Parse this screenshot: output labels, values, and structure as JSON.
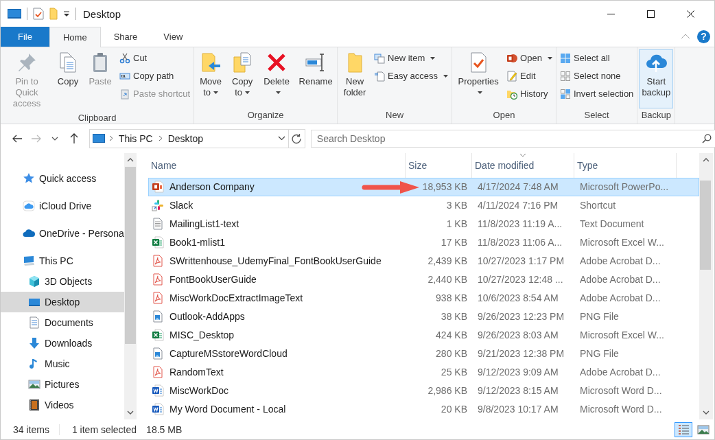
{
  "window": {
    "title": "Desktop"
  },
  "ribbon_tabs": [
    {
      "label": "File",
      "kind": "file",
      "selected": false
    },
    {
      "label": "Home",
      "kind": "tab",
      "selected": true
    },
    {
      "label": "Share",
      "kind": "tab",
      "selected": false
    },
    {
      "label": "View",
      "kind": "tab",
      "selected": false
    }
  ],
  "help_label": "?",
  "ribbon_groups": [
    {
      "label": "Clipboard",
      "items": [
        {
          "kind": "large",
          "label": "Pin to Quick access",
          "disabled": true,
          "dropdown": false,
          "highlighted": false
        },
        {
          "kind": "large",
          "label": "Copy",
          "disabled": false,
          "dropdown": false,
          "highlighted": false
        },
        {
          "kind": "large",
          "label": "Paste",
          "disabled": true,
          "dropdown": false,
          "highlighted": false
        },
        {
          "kind": "small",
          "label": "Cut",
          "disabled": false,
          "dropdown": false,
          "highlighted": false
        },
        {
          "kind": "small",
          "label": "Copy path",
          "disabled": false,
          "dropdown": false,
          "highlighted": false
        },
        {
          "kind": "small",
          "label": "Paste shortcut",
          "disabled": true,
          "dropdown": false,
          "highlighted": false
        }
      ]
    },
    {
      "label": "Organize",
      "items": [
        {
          "kind": "large",
          "label": "Move to",
          "disabled": false,
          "dropdown": true,
          "highlighted": false
        },
        {
          "kind": "large",
          "label": "Copy to",
          "disabled": false,
          "dropdown": true,
          "highlighted": false
        },
        {
          "kind": "large",
          "label": "Delete",
          "disabled": false,
          "dropdown": true,
          "highlighted": false
        },
        {
          "kind": "large",
          "label": "Rename",
          "disabled": false,
          "dropdown": false,
          "highlighted": false
        }
      ]
    },
    {
      "label": "New",
      "items": [
        {
          "kind": "large",
          "label": "New folder",
          "disabled": false,
          "dropdown": false,
          "highlighted": false
        },
        {
          "kind": "small",
          "label": "New item",
          "disabled": false,
          "dropdown": true,
          "highlighted": false
        },
        {
          "kind": "small",
          "label": "Easy access",
          "disabled": false,
          "dropdown": true,
          "highlighted": false
        }
      ]
    },
    {
      "label": "Open",
      "items": [
        {
          "kind": "large",
          "label": "Properties",
          "disabled": false,
          "dropdown": true,
          "highlighted": false
        },
        {
          "kind": "small",
          "label": "Open",
          "disabled": false,
          "dropdown": true,
          "highlighted": false
        },
        {
          "kind": "small",
          "label": "Edit",
          "disabled": false,
          "dropdown": false,
          "highlighted": false
        },
        {
          "kind": "small",
          "label": "History",
          "disabled": false,
          "dropdown": false,
          "highlighted": false
        }
      ]
    },
    {
      "label": "Select",
      "items": [
        {
          "kind": "small",
          "label": "Select all",
          "disabled": false,
          "dropdown": false,
          "highlighted": false
        },
        {
          "kind": "small",
          "label": "Select none",
          "disabled": false,
          "dropdown": false,
          "highlighted": false
        },
        {
          "kind": "small",
          "label": "Invert selection",
          "disabled": false,
          "dropdown": false,
          "highlighted": false
        }
      ]
    },
    {
      "label": "Backup",
      "items": [
        {
          "kind": "large",
          "label": "Start backup",
          "disabled": false,
          "dropdown": false,
          "highlighted": true
        }
      ]
    }
  ],
  "address": {
    "segments": [
      "This PC",
      "Desktop"
    ]
  },
  "search": {
    "placeholder": "Search Desktop"
  },
  "sidebar": {
    "items": [
      {
        "label": "Quick access",
        "selected": false
      },
      {
        "label": "iCloud Drive",
        "selected": false
      },
      {
        "label": "OneDrive - Persona",
        "selected": false
      },
      {
        "label": "This PC",
        "selected": false,
        "children": [
          {
            "label": "3D Objects",
            "selected": false
          },
          {
            "label": "Desktop",
            "selected": true
          },
          {
            "label": "Documents",
            "selected": false
          },
          {
            "label": "Downloads",
            "selected": false
          },
          {
            "label": "Music",
            "selected": false
          },
          {
            "label": "Pictures",
            "selected": false
          },
          {
            "label": "Videos",
            "selected": false
          }
        ]
      }
    ]
  },
  "table": {
    "columns": [
      {
        "label": "Name",
        "sorted": false
      },
      {
        "label": "Size",
        "sorted": false
      },
      {
        "label": "Date modified",
        "sorted": true
      },
      {
        "label": "Type",
        "sorted": false
      }
    ],
    "rows": [
      {
        "kind": "powerpoint",
        "name": "Anderson Company",
        "size": "18,953 KB",
        "date": "4/17/2024 7:48 AM",
        "type": "Microsoft PowerPo...",
        "selected": true,
        "annotated": true
      },
      {
        "kind": "shortcut",
        "name": "Slack",
        "size": "3 KB",
        "date": "4/11/2024 7:16 PM",
        "type": "Shortcut",
        "selected": false,
        "annotated": false
      },
      {
        "kind": "text",
        "name": "MailingList1-text",
        "size": "1 KB",
        "date": "11/8/2023 11:19 A...",
        "type": "Text Document",
        "selected": false,
        "annotated": false
      },
      {
        "kind": "excel",
        "name": "Book1-mlist1",
        "size": "17 KB",
        "date": "11/8/2023 11:06 A...",
        "type": "Microsoft Excel W...",
        "selected": false,
        "annotated": false
      },
      {
        "kind": "pdf",
        "name": "SWrittenhouse_UdemyFinal_FontBookUserGuide",
        "size": "2,439 KB",
        "date": "10/27/2023 1:17 PM",
        "type": "Adobe Acrobat D...",
        "selected": false,
        "annotated": false
      },
      {
        "kind": "pdf",
        "name": "FontBookUserGuide",
        "size": "2,440 KB",
        "date": "10/27/2023 12:48 ...",
        "type": "Adobe Acrobat D...",
        "selected": false,
        "annotated": false
      },
      {
        "kind": "pdf",
        "name": "MiscWorkDocExtractImageText",
        "size": "938 KB",
        "date": "10/6/2023 8:54 AM",
        "type": "Adobe Acrobat D...",
        "selected": false,
        "annotated": false
      },
      {
        "kind": "image",
        "name": "Outlook-AddApps",
        "size": "38 KB",
        "date": "9/26/2023 12:23 PM",
        "type": "PNG File",
        "selected": false,
        "annotated": false
      },
      {
        "kind": "excel",
        "name": "MISC_Desktop",
        "size": "424 KB",
        "date": "9/26/2023 8:03 AM",
        "type": "Microsoft Excel W...",
        "selected": false,
        "annotated": false
      },
      {
        "kind": "image",
        "name": "CaptureMSstoreWordCloud",
        "size": "280 KB",
        "date": "9/21/2023 12:38 PM",
        "type": "PNG File",
        "selected": false,
        "annotated": false
      },
      {
        "kind": "pdf",
        "name": "RandomText",
        "size": "25 KB",
        "date": "9/12/2023 9:09 AM",
        "type": "Adobe Acrobat D...",
        "selected": false,
        "annotated": false
      },
      {
        "kind": "word",
        "name": "MiscWorkDoc",
        "size": "2,986 KB",
        "date": "9/12/2023 8:15 AM",
        "type": "Microsoft Word D...",
        "selected": false,
        "annotated": false
      },
      {
        "kind": "word",
        "name": "My Word Document - Local",
        "size": "20 KB",
        "date": "9/8/2023 10:17 AM",
        "type": "Microsoft Word D...",
        "selected": false,
        "annotated": false
      }
    ]
  },
  "status_bar": {
    "texts": [
      "34 items",
      "1 item selected",
      "18.5 MB"
    ],
    "views": [
      {
        "kind": "details",
        "selected": true
      },
      {
        "kind": "large-icons",
        "selected": false
      }
    ]
  }
}
